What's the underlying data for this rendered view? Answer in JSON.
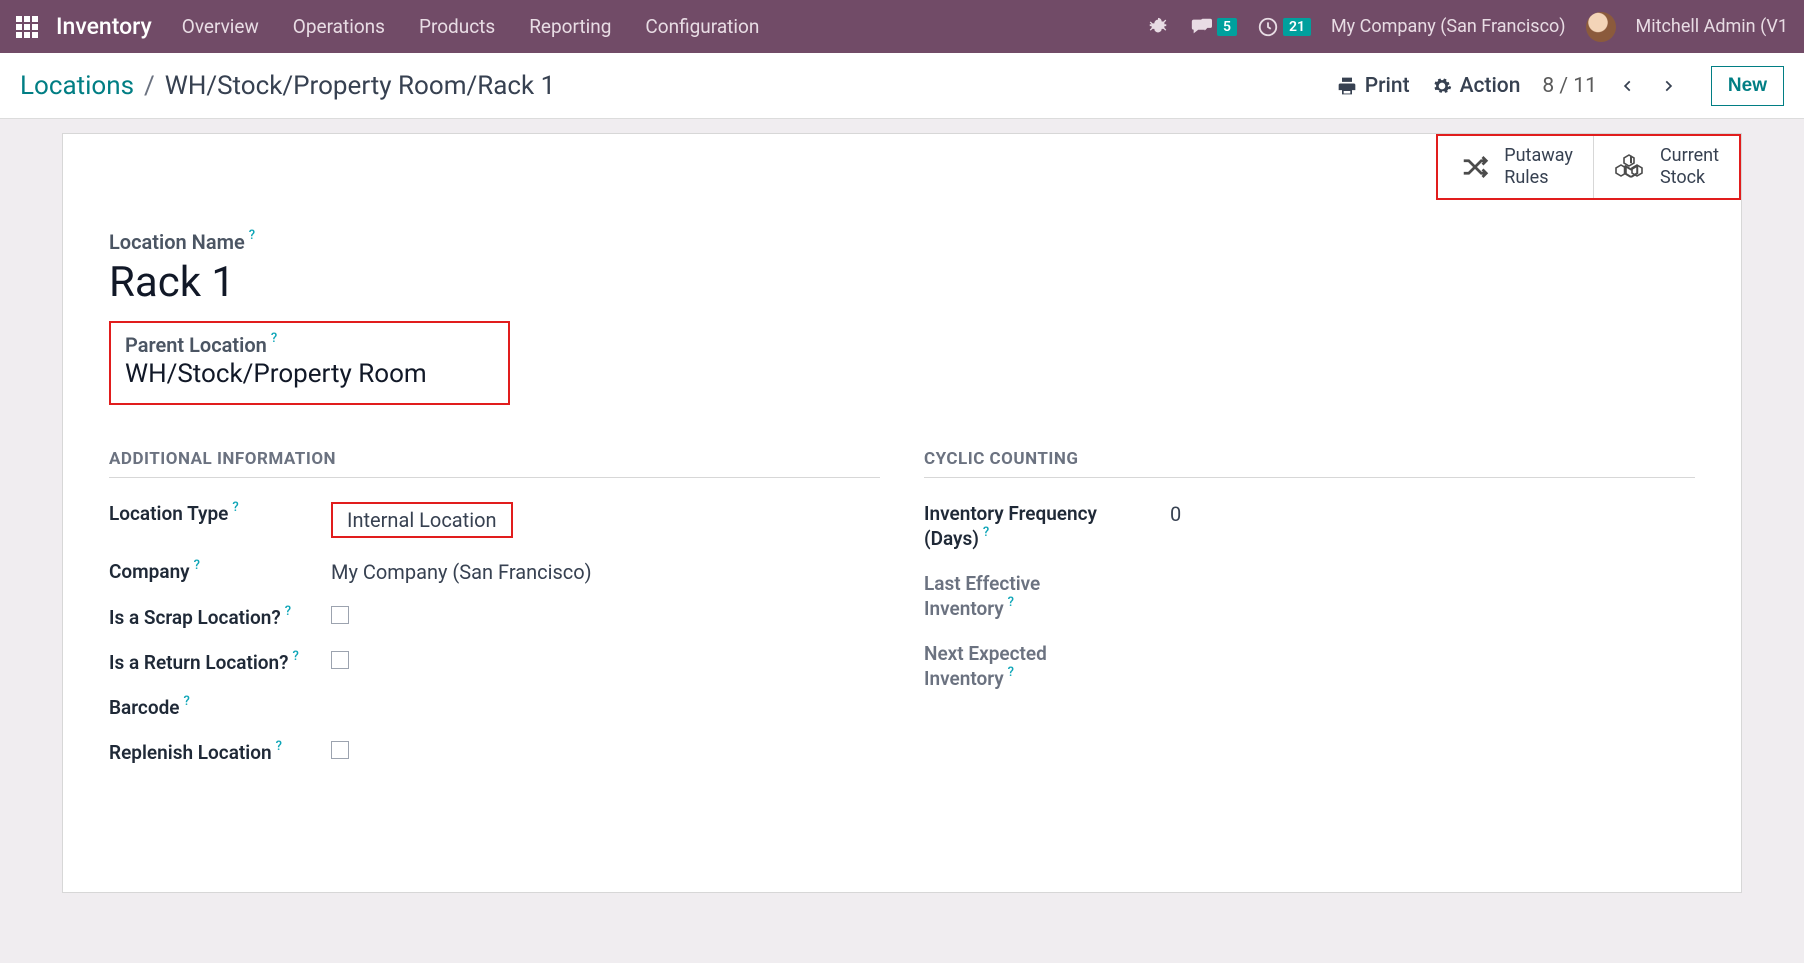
{
  "topbar": {
    "app": "Inventory",
    "menu": [
      "Overview",
      "Operations",
      "Products",
      "Reporting",
      "Configuration"
    ],
    "messages_count": "5",
    "activities_count": "21",
    "company": "My Company (San Francisco)",
    "user": "Mitchell Admin (V1"
  },
  "breadcrumb": {
    "root": "Locations",
    "current": "WH/Stock/Property Room/Rack 1"
  },
  "actions": {
    "print": "Print",
    "action": "Action",
    "pager": "8 / 11",
    "new": "New"
  },
  "stat_buttons": {
    "putaway_l1": "Putaway",
    "putaway_l2": "Rules",
    "stock_l1": "Current",
    "stock_l2": "Stock"
  },
  "form": {
    "location_name_label": "Location Name",
    "location_name": "Rack 1",
    "parent_location_label": "Parent Location",
    "parent_location": "WH/Stock/Property Room",
    "sections": {
      "additional": "Additional Information",
      "cyclic": "Cyclic Counting"
    },
    "fields": {
      "location_type_label": "Location Type",
      "location_type": "Internal Location",
      "company_label": "Company",
      "company": "My Company (San Francisco)",
      "scrap_label": "Is a Scrap Location?",
      "return_label": "Is a Return Location?",
      "barcode_label": "Barcode",
      "replenish_label": "Replenish Location",
      "inv_freq_label_l1": "Inventory Frequency",
      "inv_freq_label_l2": "(Days)",
      "inv_freq": "0",
      "last_inv_l1": "Last Effective",
      "last_inv_l2": "Inventory",
      "next_inv_l1": "Next Expected",
      "next_inv_l2": "Inventory"
    }
  }
}
